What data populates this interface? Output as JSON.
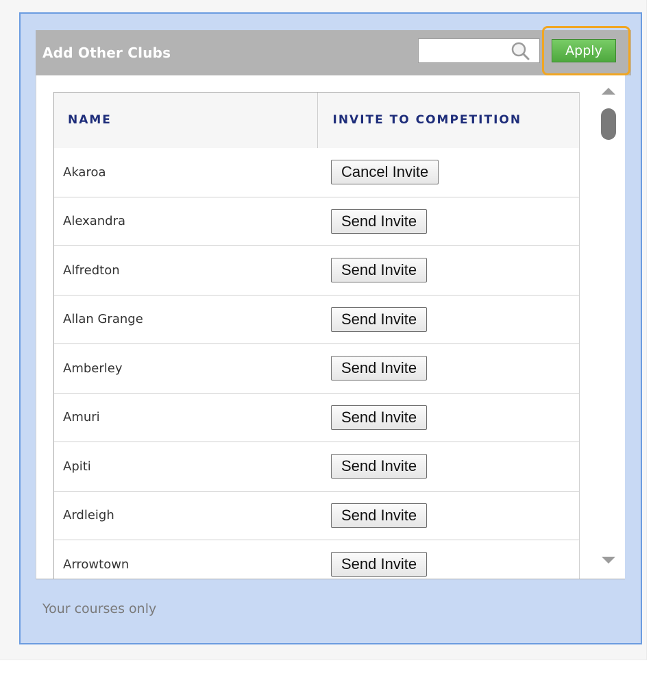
{
  "panel": {
    "title": "Add Other Clubs",
    "search": {
      "value": "",
      "placeholder": ""
    },
    "apply_label": "Apply"
  },
  "table": {
    "headers": {
      "name": "NAME",
      "invite": "INVITE TO COMPETITION"
    },
    "rows": [
      {
        "name": "Akaroa",
        "action": "Cancel Invite"
      },
      {
        "name": "Alexandra",
        "action": "Send Invite"
      },
      {
        "name": "Alfredton",
        "action": "Send Invite"
      },
      {
        "name": "Allan Grange",
        "action": "Send Invite"
      },
      {
        "name": "Amberley",
        "action": "Send Invite"
      },
      {
        "name": "Amuri",
        "action": "Send Invite"
      },
      {
        "name": "Apiti",
        "action": "Send Invite"
      },
      {
        "name": "Ardleigh",
        "action": "Send Invite"
      },
      {
        "name": "Arrowtown",
        "action": "Send Invite"
      }
    ]
  },
  "footer": {
    "text": "Your courses only"
  },
  "colors": {
    "panel_bg": "#c8d9f4",
    "panel_border": "#6b9ce0",
    "header_bg": "#b3b3b3",
    "apply_green": "#5cb84a",
    "highlight_orange": "#f0a623",
    "header_text_navy": "#1e2d7a"
  },
  "icons": {
    "search": "magnifier-icon"
  }
}
